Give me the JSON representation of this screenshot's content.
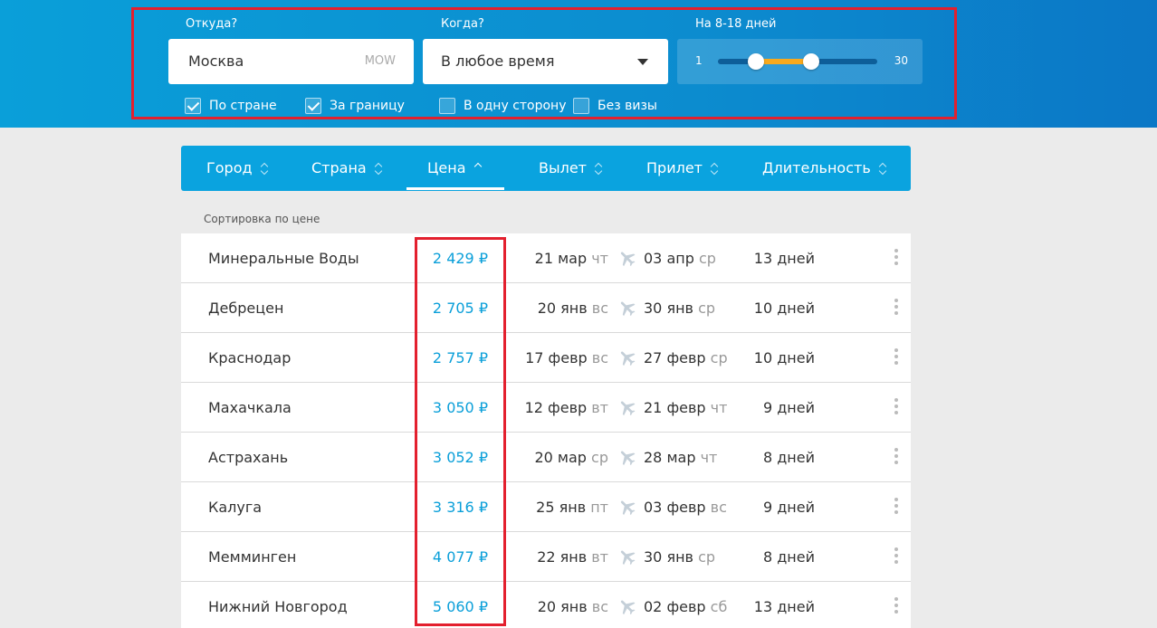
{
  "search": {
    "from_label": "Откуда?",
    "from_value": "Москва",
    "from_code": "MOW",
    "when_label": "Когда?",
    "when_value": "В любое время",
    "duration_label": "На 8-18 дней",
    "range_min": "1",
    "range_max": "30",
    "range_low": 8,
    "range_high": 18,
    "checkboxes": [
      {
        "label": "По стране",
        "checked": true
      },
      {
        "label": "За границу",
        "checked": true
      },
      {
        "label": "В одну сторону",
        "checked": false
      },
      {
        "label": "Без визы",
        "checked": false
      }
    ]
  },
  "tabs": [
    {
      "label": "Город",
      "active": false
    },
    {
      "label": "Страна",
      "active": false
    },
    {
      "label": "Цена",
      "active": true
    },
    {
      "label": "Вылет",
      "active": false
    },
    {
      "label": "Прилет",
      "active": false
    },
    {
      "label": "Длительность",
      "active": false
    }
  ],
  "sort_label": "Сортировка по цене",
  "rows": [
    {
      "city": "Минеральные Воды",
      "price": "2 429 ₽",
      "dep_date": "21 мар",
      "dep_wd": "чт",
      "arr_date": "03 апр",
      "arr_wd": "ср",
      "duration": "13 дней"
    },
    {
      "city": "Дебрецен",
      "price": "2 705 ₽",
      "dep_date": "20 янв",
      "dep_wd": "вс",
      "arr_date": "30 янв",
      "arr_wd": "ср",
      "duration": "10 дней"
    },
    {
      "city": "Краснодар",
      "price": "2 757 ₽",
      "dep_date": "17 февр",
      "dep_wd": "вс",
      "arr_date": "27 февр",
      "arr_wd": "ср",
      "duration": "10 дней"
    },
    {
      "city": "Махачкала",
      "price": "3 050 ₽",
      "dep_date": "12 февр",
      "dep_wd": "вт",
      "arr_date": "21 февр",
      "arr_wd": "чт",
      "duration": "9 дней"
    },
    {
      "city": "Астрахань",
      "price": "3 052 ₽",
      "dep_date": "20 мар",
      "dep_wd": "ср",
      "arr_date": "28 мар",
      "arr_wd": "чт",
      "duration": "8 дней"
    },
    {
      "city": "Калуга",
      "price": "3 316 ₽",
      "dep_date": "25 янв",
      "dep_wd": "пт",
      "arr_date": "03 февр",
      "arr_wd": "вс",
      "duration": "9 дней"
    },
    {
      "city": "Мемминген",
      "price": "4 077 ₽",
      "dep_date": "22 янв",
      "dep_wd": "вт",
      "arr_date": "30 янв",
      "arr_wd": "ср",
      "duration": "8 дней"
    },
    {
      "city": "Нижний Новгород",
      "price": "5 060 ₽",
      "dep_date": "20 янв",
      "dep_wd": "вс",
      "arr_date": "02 февр",
      "arr_wd": "сб",
      "duration": "13 дней"
    }
  ],
  "colors": {
    "accent": "#0aa3df",
    "range_fill": "#f8a91e",
    "highlight": "#e3202e"
  }
}
